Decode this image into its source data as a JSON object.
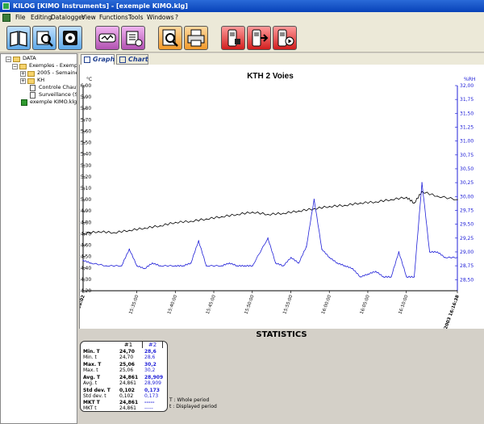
{
  "window": {
    "title": "KILOG [KIMO Instruments] - [exemple KIMO.klg]"
  },
  "menu": [
    "File",
    "Editing",
    "Datalogger",
    "View",
    "Functions",
    "Tools",
    "Windows",
    "?"
  ],
  "toolbar": {
    "buttons": [
      {
        "name": "open-book-icon",
        "color": "blue"
      },
      {
        "name": "search-map-icon",
        "color": "blue"
      },
      {
        "name": "disk-icon",
        "color": "blue"
      },
      {
        "name": "datalogger-icon",
        "color": "purple"
      },
      {
        "name": "export-icon",
        "color": "purple"
      },
      {
        "name": "preview-icon",
        "color": "orange"
      },
      {
        "name": "printer-icon",
        "color": "orange"
      },
      {
        "name": "device-config-icon",
        "color": "red"
      },
      {
        "name": "device-download-icon",
        "color": "red"
      },
      {
        "name": "device-play-icon",
        "color": "red"
      }
    ]
  },
  "tree": {
    "items": [
      {
        "label": "DATA",
        "level": 0,
        "expander": "-",
        "type": "folder"
      },
      {
        "label": "Exemples - Exemples",
        "level": 1,
        "expander": "-",
        "type": "folder"
      },
      {
        "label": "2005 - Semaine 5",
        "level": 2,
        "expander": "+",
        "type": "folder"
      },
      {
        "label": "KH",
        "level": 2,
        "expander": "+",
        "type": "folder"
      },
      {
        "label": "Controle Chauffag",
        "level": 2,
        "expander": "",
        "type": "file"
      },
      {
        "label": "Surveillance (Surv",
        "level": 2,
        "expander": "",
        "type": "file"
      },
      {
        "label": "exemple KIMO.klg",
        "level": 1,
        "expander": "",
        "type": "klg"
      }
    ]
  },
  "tabs": [
    {
      "label": "Graph",
      "active": true
    },
    {
      "label": "Chart",
      "active": false
    }
  ],
  "chart_data": {
    "type": "line",
    "title": "KTH 2 Voies",
    "left_axis_unit": "°C",
    "right_axis_unit": "%RH",
    "ylim_left": [
      24.2,
      26.0
    ],
    "ylim_right": [
      28.3,
      32.0
    ],
    "left_ticks": [
      "26,00",
      "25,90",
      "25,80",
      "25,70",
      "25,60",
      "25,50",
      "25,40",
      "25,30",
      "25,20",
      "25,10",
      "25,00",
      "24,90",
      "24,80",
      "24,70",
      "24,60",
      "24,50",
      "24,40",
      "24,30",
      "24,20"
    ],
    "right_ticks": [
      "32,00",
      "31,75",
      "31,50",
      "31,25",
      "31,00",
      "30,75",
      "30,50",
      "30,25",
      "30,00",
      "29,75",
      "29,50",
      "29,25",
      "29,00",
      "28,75",
      "28,50"
    ],
    "x_ticks": [
      "20/12/2003 15:28:02",
      "15:35:00",
      "15:40:00",
      "15:45:00",
      "15:50:00",
      "15:55:00",
      "16:00:00",
      "16:05:00",
      "16:10:00",
      "20/12/2003 16:16:38"
    ],
    "x_start_minutes": 0,
    "x_end_minutes": 48.6,
    "series": [
      {
        "name": "#1",
        "axis": "left",
        "color": "#000000",
        "x": [
          0,
          2,
          4,
          6,
          8,
          10,
          12,
          14,
          16,
          18,
          20,
          22,
          24,
          26,
          28,
          30,
          32,
          34,
          36,
          38,
          40,
          42,
          43,
          44,
          46,
          48.6
        ],
        "values": [
          24.7,
          24.72,
          24.71,
          24.73,
          24.75,
          24.77,
          24.8,
          24.81,
          24.83,
          24.85,
          24.87,
          24.89,
          24.87,
          24.88,
          24.9,
          24.92,
          24.94,
          24.95,
          24.97,
          24.98,
          25.0,
          25.02,
          24.97,
          25.07,
          25.03,
          25.0
        ]
      },
      {
        "name": "#2",
        "axis": "right",
        "color": "#2121d8",
        "x": [
          0,
          1,
          3,
          5,
          6,
          7,
          8,
          9,
          10,
          12,
          13,
          14,
          15,
          16,
          18,
          19,
          20,
          21,
          22,
          24,
          25,
          26,
          27,
          28,
          29,
          30,
          31,
          32,
          33,
          34,
          35,
          36,
          37,
          38,
          39,
          40,
          41,
          42,
          43,
          44,
          45,
          46,
          47,
          48.6
        ],
        "values": [
          28.85,
          28.8,
          28.75,
          28.75,
          29.05,
          28.75,
          28.7,
          28.8,
          28.75,
          28.75,
          28.75,
          28.8,
          29.2,
          28.75,
          28.75,
          28.8,
          28.75,
          28.75,
          28.75,
          29.25,
          28.8,
          28.75,
          28.9,
          28.8,
          29.1,
          29.95,
          29.05,
          28.9,
          28.8,
          28.75,
          28.7,
          28.55,
          28.6,
          28.65,
          28.55,
          28.55,
          29.0,
          28.55,
          28.55,
          30.25,
          29.0,
          29.0,
          28.9,
          28.9
        ]
      }
    ]
  },
  "stats": {
    "title": "STATISTICS",
    "col1": "#1",
    "col2": "#2",
    "rows": [
      {
        "label": "Min. T",
        "v1": "24,70",
        "v2": "28,6",
        "bold": true
      },
      {
        "label": "Min. t",
        "v1": "24,70",
        "v2": "28,6",
        "bold": false
      },
      {
        "label": "Max. T",
        "v1": "25,06",
        "v2": "30,2",
        "bold": true
      },
      {
        "label": "Max. t",
        "v1": "25,06",
        "v2": "30,2",
        "bold": false
      },
      {
        "label": "Avg. T",
        "v1": "24,861",
        "v2": "28,909",
        "bold": true
      },
      {
        "label": "Avg. t",
        "v1": "24,861",
        "v2": "28,909",
        "bold": false
      },
      {
        "label": "Std dev. T",
        "v1": "0,102",
        "v2": "0,173",
        "bold": true
      },
      {
        "label": "Std dev. t",
        "v1": "0,102",
        "v2": "0,173",
        "bold": false
      },
      {
        "label": "MKT T",
        "v1": "24,861",
        "v2": "-----",
        "bold": true
      },
      {
        "label": "MKT t",
        "v1": "24,861",
        "v2": "-----",
        "bold": false
      }
    ],
    "legend_whole": "T : Whole period",
    "legend_displayed": "t : Displayed period"
  }
}
